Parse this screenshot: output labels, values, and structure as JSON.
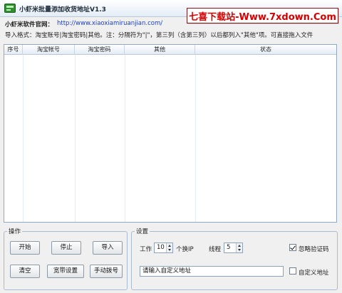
{
  "window": {
    "title": "小虾米批量添加收货地址V1.3",
    "watermark": "七喜下载站-Www.7xdown.Com"
  },
  "info": {
    "site_label": "小虾米软件官网：",
    "site_url": "http://www.xiaoxiamiruanjian.com/",
    "format_hint": "导入格式：淘宝账号|淘宝密码|其他。注：分隔符为\"|\"，第三列（含第三列）以后都列入\"其他\"项。可直接拖入文件"
  },
  "table": {
    "columns": [
      "序号",
      "淘宝帐号",
      "淘宝密码",
      "其他",
      "状态"
    ],
    "rows": []
  },
  "operations": {
    "legend": "操作",
    "start": "开始",
    "stop": "停止",
    "import": "导入",
    "clear": "清空",
    "broadband": "宽带设置",
    "dial": "手动拨号"
  },
  "settings": {
    "legend": "设置",
    "work_label": "工作",
    "work_value": "10",
    "per_ip_label": "个换IP",
    "threads_label": "线程",
    "threads_value": "5",
    "ignore_captcha_label": "忽略验证码",
    "ignore_captcha_checked": true,
    "custom_address_value": "请输入自定义地址",
    "custom_address_label": "自定义地址",
    "custom_address_checked": false
  }
}
